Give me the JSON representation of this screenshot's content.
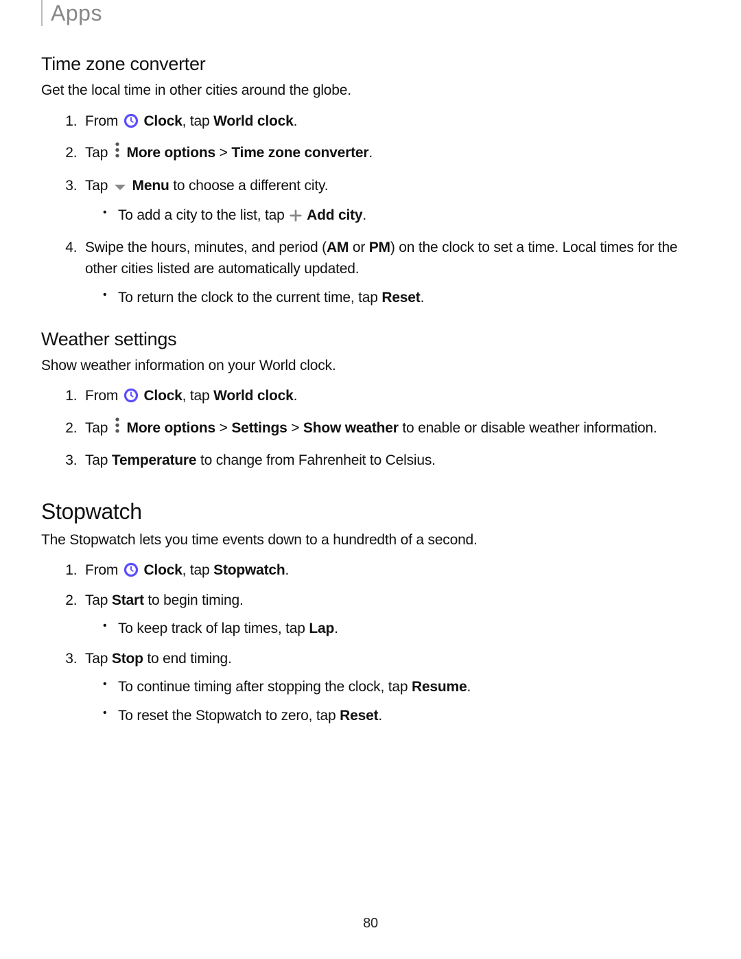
{
  "header": "Apps",
  "page_number": "80",
  "tzc": {
    "heading": "Time zone converter",
    "intro": "Get the local time in other cities around the globe.",
    "step1_a": "From ",
    "step1_b": " Clock",
    "step1_c": ", tap ",
    "step1_d": "World clock",
    "step1_e": ".",
    "step2_a": "Tap ",
    "step2_b": " More options",
    "step2_c": " > ",
    "step2_d": "Time zone converter",
    "step2_e": ".",
    "step3_a": "Tap ",
    "step3_b": " Menu",
    "step3_c": " to choose a different city.",
    "step3_bul_a": "To add a city to the list, tap ",
    "step3_bul_b": " Add city",
    "step3_bul_c": ".",
    "step4_a": "Swipe the hours, minutes, and period (",
    "step4_b": "AM",
    "step4_c": " or ",
    "step4_d": "PM",
    "step4_e": ") on the clock to set a time. Local times for the other cities listed are automatically updated.",
    "step4_bul_a": "To return the clock to the current time, tap ",
    "step4_bul_b": "Reset",
    "step4_bul_c": "."
  },
  "ws": {
    "heading": "Weather settings",
    "intro": "Show weather information on your World clock.",
    "step1_a": "From ",
    "step1_b": " Clock",
    "step1_c": ", tap ",
    "step1_d": "World clock",
    "step1_e": ".",
    "step2_a": "Tap ",
    "step2_b": " More options",
    "step2_c": " > ",
    "step2_d": "Settings",
    "step2_e": " > ",
    "step2_f": "Show weather",
    "step2_g": " to enable or disable weather information.",
    "step3_a": "Tap ",
    "step3_b": "Temperature",
    "step3_c": " to change from Fahrenheit to Celsius."
  },
  "sw": {
    "heading": "Stopwatch",
    "intro": "The Stopwatch lets you time events down to a hundredth of a second.",
    "step1_a": "From ",
    "step1_b": " Clock",
    "step1_c": ", tap ",
    "step1_d": "Stopwatch",
    "step1_e": ".",
    "step2_a": "Tap ",
    "step2_b": "Start",
    "step2_c": " to begin timing.",
    "step2_bul_a": "To keep track of lap times, tap ",
    "step2_bul_b": "Lap",
    "step2_bul_c": ".",
    "step3_a": " Tap ",
    "step3_b": "Stop",
    "step3_c": " to end timing.",
    "step3_bul1_a": "To continue timing after stopping the clock, tap ",
    "step3_bul1_b": "Resume",
    "step3_bul1_c": ".",
    "step3_bul2_a": "To reset the Stopwatch to zero, tap ",
    "step3_bul2_b": "Reset",
    "step3_bul2_c": "."
  }
}
